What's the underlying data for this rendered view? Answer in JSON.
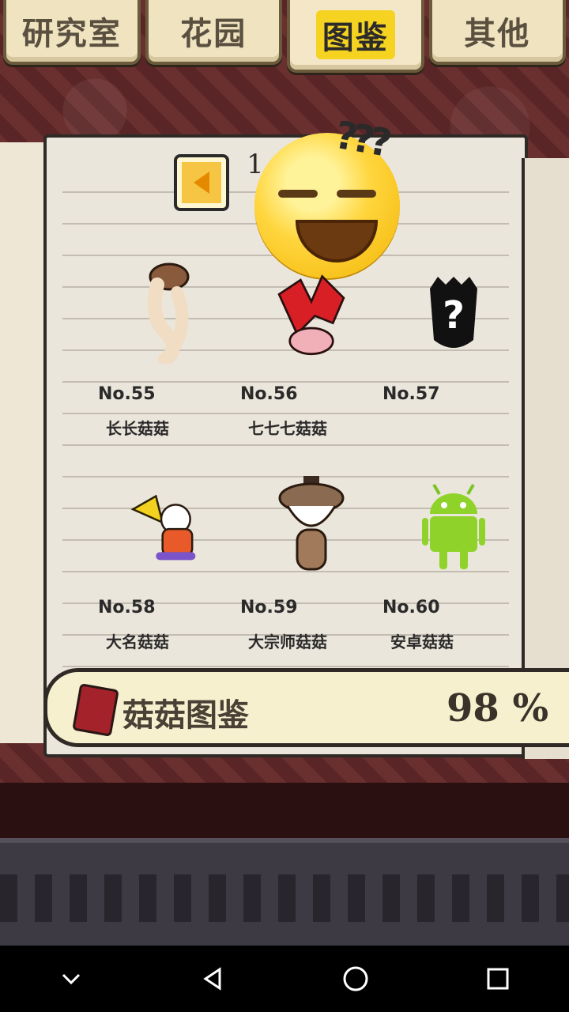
{
  "tabs": [
    {
      "label": "研究室",
      "active": false
    },
    {
      "label": "花园",
      "active": false
    },
    {
      "label": "图鉴",
      "active": true
    },
    {
      "label": "其他",
      "active": false
    }
  ],
  "book": {
    "page_number": "1",
    "emoji_overlay": "???",
    "items": [
      {
        "no": "No.55",
        "name": "长长菇菇",
        "icon": "mushroom-long-icon"
      },
      {
        "no": "No.56",
        "name": "七七七菇菇",
        "icon": "mushroom-red-icon"
      },
      {
        "no": "No.57",
        "name": "",
        "icon": "unknown-silhouette-icon"
      },
      {
        "no": "No.58",
        "name": "大名菇菇",
        "icon": "mushroom-daimyo-icon"
      },
      {
        "no": "No.59",
        "name": "大宗师菇菇",
        "icon": "mushroom-master-icon"
      },
      {
        "no": "No.60",
        "name": "安卓菇菇",
        "icon": "android-icon"
      }
    ]
  },
  "footer": {
    "label": "菇菇图鉴",
    "percent": "98",
    "percent_sign": "%"
  },
  "colors": {
    "active_tab": "#f6d320",
    "background": "#5a2526",
    "page": "#ebe6db"
  }
}
